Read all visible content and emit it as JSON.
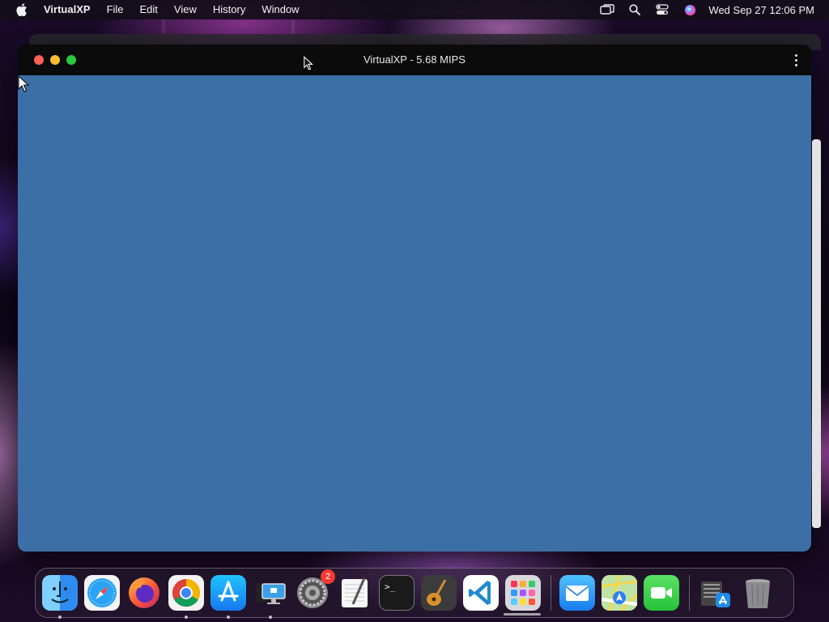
{
  "menubar": {
    "app_name": "VirtualXP",
    "menus": [
      "File",
      "Edit",
      "View",
      "History",
      "Window"
    ],
    "clock": "Wed Sep 27  12:06 PM",
    "status_icons": [
      "screen-mirroring-icon",
      "spotlight-search-icon",
      "control-center-icon",
      "siri-icon"
    ]
  },
  "window": {
    "title": "VirtualXP - 5.68 MIPS",
    "screen_color": "#3c6fa6"
  },
  "dock": {
    "apps": [
      {
        "name": "Finder",
        "icon": "finder-icon",
        "running": true
      },
      {
        "name": "Safari",
        "icon": "safari-icon",
        "running": false
      },
      {
        "name": "Firefox",
        "icon": "firefox-icon",
        "running": false
      },
      {
        "name": "Google Chrome",
        "icon": "chrome-icon",
        "running": true
      },
      {
        "name": "App Store",
        "icon": "app-store-icon",
        "running": true
      },
      {
        "name": "Remote Desktop",
        "icon": "remote-desktop-icon",
        "running": true
      },
      {
        "name": "System Settings",
        "icon": "settings-gear-icon",
        "running": false,
        "badge": "2"
      },
      {
        "name": "TextEdit",
        "icon": "textedit-icon",
        "running": false
      },
      {
        "name": "Terminal",
        "icon": "terminal-icon",
        "running": false
      },
      {
        "name": "GarageBand",
        "icon": "garageband-icon",
        "running": false
      },
      {
        "name": "Visual Studio Code",
        "icon": "vscode-icon",
        "running": false
      },
      {
        "name": "Launchpad",
        "icon": "launchpad-icon",
        "running": false
      },
      {
        "name": "Mail",
        "icon": "mail-icon",
        "running": false
      },
      {
        "name": "Maps",
        "icon": "maps-icon",
        "running": false
      },
      {
        "name": "FaceTime",
        "icon": "facetime-icon",
        "running": false
      },
      {
        "name": "Downloads",
        "icon": "downloads-stack-icon",
        "running": false
      },
      {
        "name": "Trash",
        "icon": "trash-icon",
        "running": false
      }
    ]
  }
}
